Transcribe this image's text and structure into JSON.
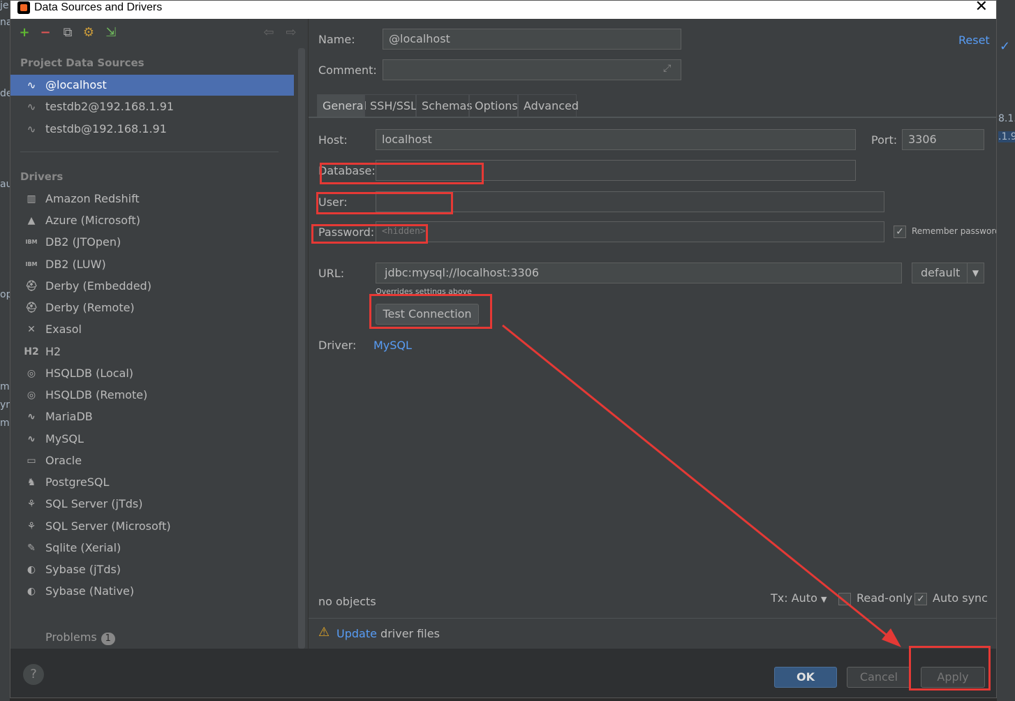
{
  "window": {
    "title": "Data Sources and Drivers",
    "close_label": "✕"
  },
  "toolbar": {
    "add": "+",
    "remove": "−",
    "copy": "⧉",
    "settings": "⚙",
    "import": "⇲",
    "back": "⇦",
    "forward": "⇨"
  },
  "left": {
    "project_header": "Project Data Sources",
    "sources": [
      {
        "label": "@localhost",
        "icon": "mysql-dolphin-icon"
      },
      {
        "label": "testdb2@192.168.1.91",
        "icon": "mysql-dolphin-icon"
      },
      {
        "label": "testdb@192.168.1.91",
        "icon": "mysql-dolphin-icon"
      }
    ],
    "drivers_header": "Drivers",
    "drivers": [
      {
        "label": "Amazon Redshift",
        "glyph": "▥"
      },
      {
        "label": "Azure (Microsoft)",
        "glyph": "▲"
      },
      {
        "label": "DB2 (JTOpen)",
        "glyph": "IBM"
      },
      {
        "label": "DB2 (LUW)",
        "glyph": "IBM"
      },
      {
        "label": "Derby (Embedded)",
        "glyph": "⛑"
      },
      {
        "label": "Derby (Remote)",
        "glyph": "⛑"
      },
      {
        "label": "Exasol",
        "glyph": "✕"
      },
      {
        "label": "H2",
        "glyph": "H2"
      },
      {
        "label": "HSQLDB (Local)",
        "glyph": "◎"
      },
      {
        "label": "HSQLDB (Remote)",
        "glyph": "◎"
      },
      {
        "label": "MariaDB",
        "glyph": "∿"
      },
      {
        "label": "MySQL",
        "glyph": "∿"
      },
      {
        "label": "Oracle",
        "glyph": "▭"
      },
      {
        "label": "PostgreSQL",
        "glyph": "♞"
      },
      {
        "label": "SQL Server (jTds)",
        "glyph": "⚘"
      },
      {
        "label": "SQL Server (Microsoft)",
        "glyph": "⚘"
      },
      {
        "label": "Sqlite (Xerial)",
        "glyph": "✎"
      },
      {
        "label": "Sybase (jTds)",
        "glyph": "◐"
      },
      {
        "label": "Sybase (Native)",
        "glyph": "◐"
      }
    ],
    "problems_label": "Problems",
    "problems_count": "1"
  },
  "form": {
    "name_label": "Name:",
    "name_value": "@localhost",
    "comment_label": "Comment:",
    "comment_value": "",
    "reset_label": "Reset",
    "tabs": [
      "General",
      "SSH/SSL",
      "Schemas",
      "Options",
      "Advanced"
    ],
    "host_label": "Host:",
    "host_value": "localhost",
    "port_label": "Port:",
    "port_value": "3306",
    "database_label": "Database:",
    "database_value": "",
    "user_label": "User:",
    "user_value": "",
    "password_label": "Password:",
    "password_value": "<hidden>",
    "remember_label": "Remember password",
    "url_label": "URL:",
    "url_value": "jdbc:mysql://localhost:3306",
    "url_mode": "default",
    "overrides_note": "Overrides settings above",
    "test_connection": "Test Connection",
    "driver_label": "Driver:",
    "driver_value": "MySQL",
    "objects_status": "no objects",
    "tx_label": "Tx: Auto",
    "readonly_label": "Read-only",
    "autosync_label": "Auto sync",
    "update_link": "Update",
    "update_text": " driver files"
  },
  "buttons": {
    "ok": "OK",
    "cancel": "Cancel",
    "apply": "Apply",
    "help": "?"
  },
  "background": {
    "frag1": "je",
    "frag2": "na",
    "frag3": "de",
    "frag4": "au",
    "frag5": "op",
    "frag6": "m",
    "frag7": "yn",
    "frag8": "m",
    "frag9": "8.1.",
    ".frag10": "",
    "frag10": ".1.9"
  },
  "colors": {
    "accent": "#4b6eaf",
    "link": "#589df6",
    "annotation": "#e53935"
  }
}
